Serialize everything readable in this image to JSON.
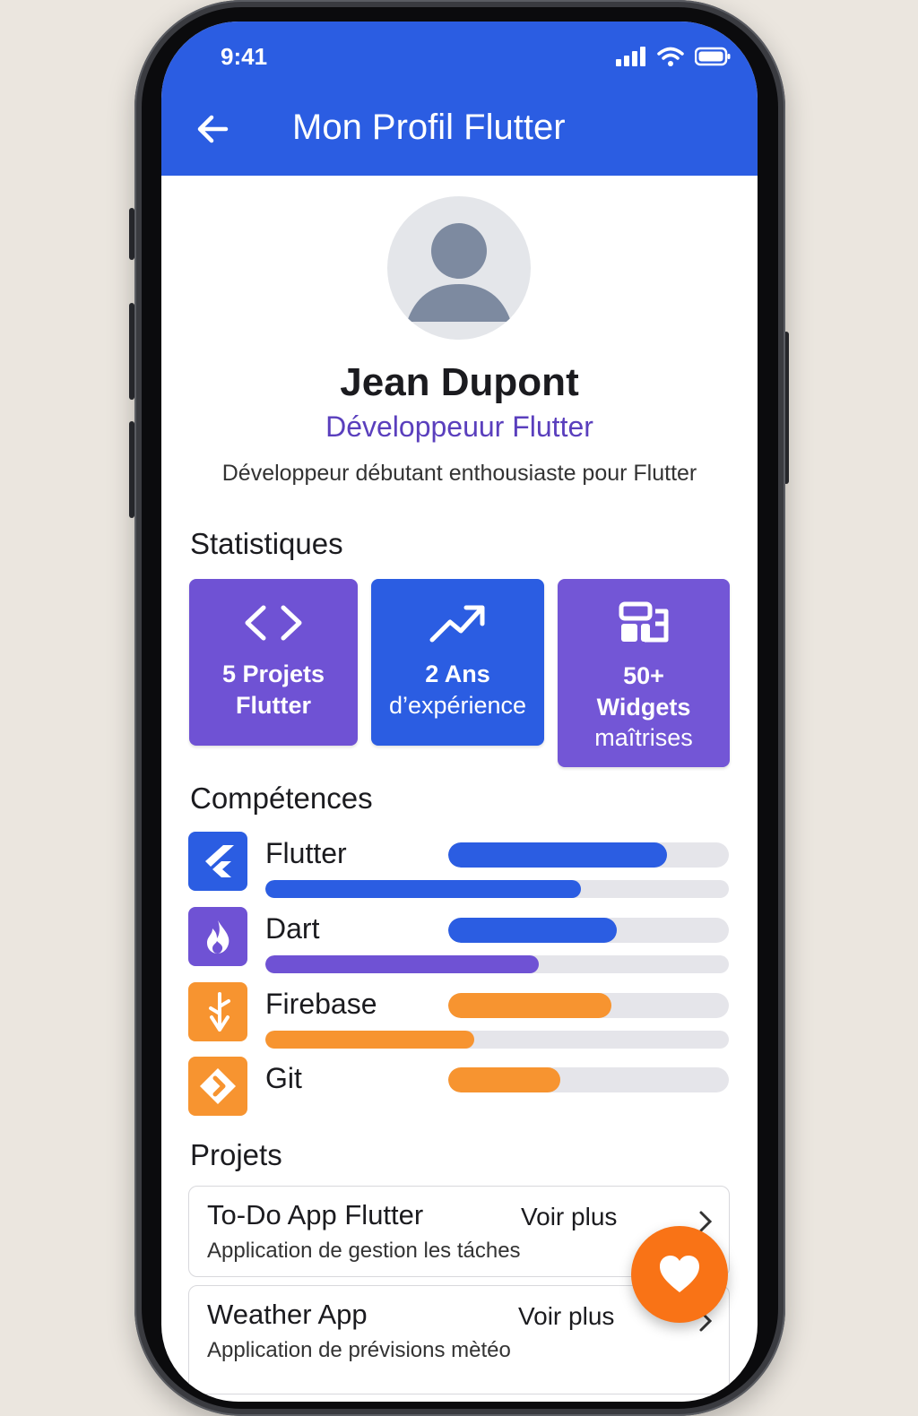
{
  "status_bar": {
    "time": "9:41"
  },
  "app_bar": {
    "title": "Mon Profil Flutter",
    "back_icon": "arrow-left-icon"
  },
  "profile": {
    "name": "Jean Dupont",
    "role": "Développeuur Flutter",
    "bio": "Développeur débutant enthousiaste pour Flutter",
    "avatar_icon": "person-icon"
  },
  "stats": {
    "title": "Statistiques",
    "items": [
      {
        "line1": "5 Projets",
        "line2": "Flutter",
        "line3": "",
        "icon": "code-icon",
        "color": "#6f52d4"
      },
      {
        "line1": "2 Ans",
        "line2": "d’expérience",
        "line3": "",
        "icon": "trending-up-icon",
        "color": "#2b5de2"
      },
      {
        "line1": "50+",
        "line2": "Widgets",
        "line3": "maîtrises",
        "icon": "widgets-icon",
        "color": "#7356d6"
      }
    ]
  },
  "skills": {
    "title": "Compétences",
    "items": [
      {
        "name": "Flutter",
        "icon": "flutter-icon",
        "icon_color": "#2b5de2",
        "level": 0.78,
        "secondary_level": 0.68,
        "bar_color": "#2b5de2",
        "secondary_color": "#2b5de2"
      },
      {
        "name": "Dart",
        "icon": "flame-icon",
        "icon_color": "#6f52d4",
        "level": 0.6,
        "secondary_level": 0.59,
        "bar_color": "#2b5de2",
        "secondary_color": "#6f52d4"
      },
      {
        "name": "Firebase",
        "icon": "firebase-icon",
        "icon_color": "#f79430",
        "level": 0.58,
        "secondary_level": 0.45,
        "bar_color": "#f79430",
        "secondary_color": "#f79430"
      },
      {
        "name": "Git",
        "icon": "git-icon",
        "icon_color": "#f79430",
        "level": 0.4,
        "bar_color": "#f79430"
      }
    ]
  },
  "projects": {
    "title": "Projets",
    "items": [
      {
        "title": "To-Do App Flutter",
        "more": "Voir plus",
        "description": "Application de gestion les táches"
      },
      {
        "title": "Weather App",
        "more": "Voir plus",
        "description": "Application de prévisions mètéo"
      }
    ]
  },
  "fab": {
    "icon": "heart-icon",
    "color": "#f97316"
  }
}
